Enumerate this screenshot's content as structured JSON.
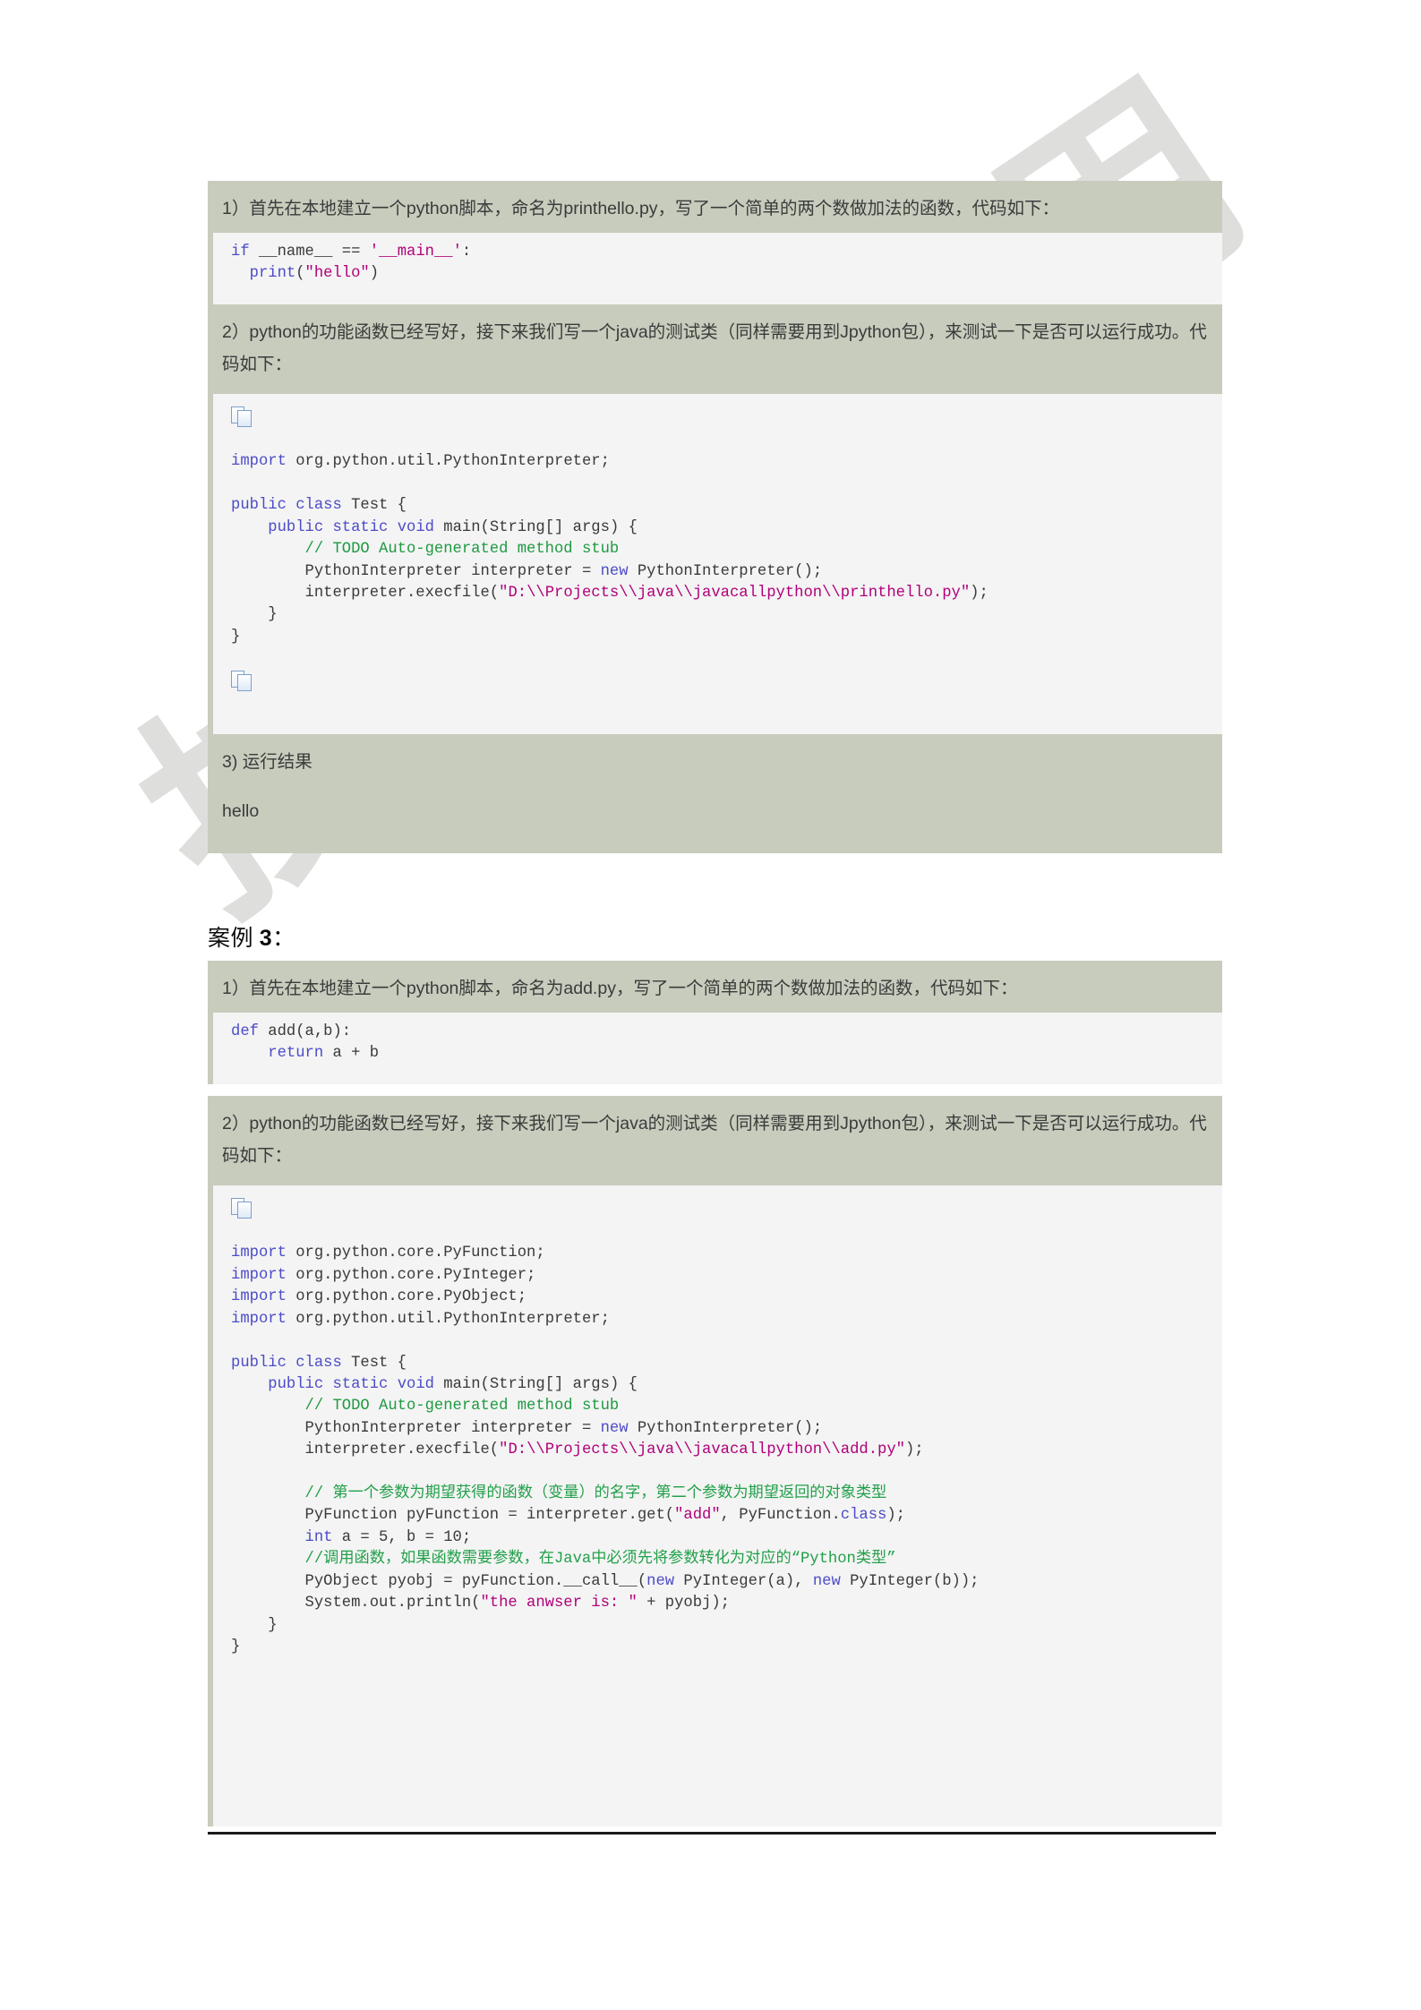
{
  "watermark": {
    "text": "技术与应用"
  },
  "document": {
    "sections": [
      {
        "id": "case2",
        "steps": [
          {
            "label": "step1_text",
            "text": "1）首先在本地建立一个python脚本，命名为printhello.py，写了一个简单的两个数做加法的函数，代码如下："
          },
          {
            "label": "step2_text",
            "text": "2）python的功能函数已经写好，接下来我们写一个java的测试类（同样需要用到Jpython包），来测试一下是否可以运行成功。代码如下："
          },
          {
            "label": "step3_text",
            "text": "3) 运行结果"
          },
          {
            "label": "result_text",
            "text": "hello"
          }
        ],
        "python_code": {
          "line1_kw": "if",
          "line1_name": " __name__ ",
          "line1_op": "== ",
          "line1_str": "'__main__'",
          "line1_end": ":",
          "line2_fn": "  print",
          "line2_open": "(",
          "line2_str": "\"hello\"",
          "line2_close": ")"
        },
        "java_code": {
          "import1_kw": "import",
          "import1_rest": " org.python.util.PythonInterpreter;",
          "class_kw1": "public",
          "class_kw2": "class",
          "class_name": " Test {",
          "main_kw1": "    public",
          "main_kw2": "static",
          "main_kw3": "void",
          "main_rest": " main(String[] args) {",
          "todo_comment": "        // TODO Auto-generated method stub",
          "interp_pre": "        PythonInterpreter interpreter = ",
          "interp_new": "new",
          "interp_post": " PythonInterpreter();",
          "execfile_pre": "        interpreter.execfile(",
          "execfile_str": "\"D:\\\\Projects\\\\java\\\\javacallpython\\\\printhello.py\"",
          "execfile_post": ");",
          "close_inner": "    }",
          "close_outer": "}"
        }
      },
      {
        "id": "case3",
        "heading_cn": "案例 ",
        "heading_num": "3",
        "heading_colon": "：",
        "steps": [
          {
            "label": "step1_text",
            "text": "1）首先在本地建立一个python脚本，命名为add.py，写了一个简单的两个数做加法的函数，代码如下："
          },
          {
            "label": "step2_text",
            "text": "2）python的功能函数已经写好，接下来我们写一个java的测试类（同样需要用到Jpython包），来测试一下是否可以运行成功。代码如下："
          }
        ],
        "python_code": {
          "def_kw": "def",
          "def_rest": " add(a,b):",
          "return_indent": "    ",
          "return_kw": "return",
          "return_rest": " a + b"
        },
        "java_code": {
          "import_kw": "import",
          "import1_rest": " org.python.core.PyFunction;",
          "import2_rest": " org.python.core.PyInteger;",
          "import3_rest": " org.python.core.PyObject;",
          "import4_rest": " org.python.util.PythonInterpreter;",
          "class_kw1": "public",
          "class_kw2": "class",
          "class_name": " Test {",
          "main_kw1": "    public",
          "main_kw2": "static",
          "main_kw3": "void",
          "main_rest": " main(String[] args) {",
          "todo_comment": "        // TODO Auto-generated method stub",
          "interp_pre": "        PythonInterpreter interpreter = ",
          "interp_new": "new",
          "interp_post": " PythonInterpreter();",
          "execfile_pre": "        interpreter.execfile(",
          "execfile_str": "\"D:\\\\Projects\\\\java\\\\javacallpython\\\\add.py\"",
          "execfile_post": ");",
          "cn_comment1": "        // 第一个参数为期望获得的函数（变量）的名字，第二个参数为期望返回的对象类型",
          "pyfunc_pre": "        PyFunction pyFunction = interpreter.get(",
          "pyfunc_str": "\"add\"",
          "pyfunc_mid": ", PyFunction.",
          "pyfunc_kw": "class",
          "pyfunc_post": ");",
          "int_indent": "        ",
          "int_kw": "int",
          "int_rest": " a = 5, b = 10;",
          "cn_comment2": "        //调用函数，如果函数需要参数，在Java中必须先将参数转化为对应的“Python类型”",
          "pyobj_pre": "        PyObject pyobj = pyFunction.__call__(",
          "pyobj_new1": "new",
          "pyobj_mid": " PyInteger(a), ",
          "pyobj_new2": "new",
          "pyobj_post": " PyInteger(b));",
          "println_pre": "        System.out.println(",
          "println_str": "\"the anwser is: \"",
          "println_post": " + pyobj);",
          "close_inner": "    }",
          "close_outer": "}"
        }
      }
    ]
  },
  "icons": {
    "copy": "copy-icon"
  }
}
